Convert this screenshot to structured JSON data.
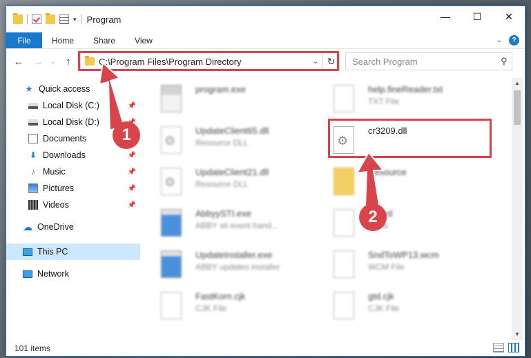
{
  "window": {
    "title": "Program",
    "minimize": "—",
    "maximize": "☐",
    "close": "✕"
  },
  "ribbon": {
    "tabs": [
      "File",
      "Home",
      "Share",
      "View"
    ],
    "help": "?"
  },
  "address": {
    "path": "C:\\Program Files\\Program Directory",
    "search_placeholder": "Search Program"
  },
  "sidebar": {
    "items": [
      {
        "label": "Quick access",
        "icon": "star-icon"
      },
      {
        "label": "Local Disk (C:)",
        "icon": "disk-icon",
        "pinned": true
      },
      {
        "label": "Local Disk (D:)",
        "icon": "disk-icon",
        "pinned": true
      },
      {
        "label": "Documents",
        "icon": "documents-icon",
        "pinned": true
      },
      {
        "label": "Downloads",
        "icon": "downloads-icon",
        "pinned": true
      },
      {
        "label": "Music",
        "icon": "music-icon",
        "pinned": true
      },
      {
        "label": "Pictures",
        "icon": "pictures-icon",
        "pinned": true
      },
      {
        "label": "Videos",
        "icon": "videos-icon",
        "pinned": true
      },
      {
        "label": "OneDrive",
        "icon": "cloud-icon"
      },
      {
        "label": "This PC",
        "icon": "pc-icon",
        "selected": true
      },
      {
        "label": "Network",
        "icon": "network-icon"
      }
    ]
  },
  "files": [
    {
      "name": "program.exe",
      "type": ""
    },
    {
      "name": "help.fineReader.txt",
      "type": "TXT File"
    },
    {
      "name": "UpdateClient65.dll",
      "type": "Resource DLL"
    },
    {
      "name": "cr3209.dll",
      "type": ""
    },
    {
      "name": "UpdateClient21.dll",
      "type": "Resource DLL"
    },
    {
      "name": "Resource",
      "type": ""
    },
    {
      "name": "AbbyySTI.exe",
      "type": "ABBY sti event hand..."
    },
    {
      "name": "....wrd",
      "type": "...File"
    },
    {
      "name": "UpdateInstaller.exe",
      "type": "ABBY updates installer"
    },
    {
      "name": "SndToWP13.wcm",
      "type": "WCM File"
    },
    {
      "name": "FastKorn.cjk",
      "type": "CJK File"
    },
    {
      "name": "gtd.cjk",
      "type": "CJK File"
    }
  ],
  "status": {
    "count": "101 items"
  },
  "annotations": {
    "step1": "1",
    "step2": "2",
    "color": "#d9434a"
  }
}
